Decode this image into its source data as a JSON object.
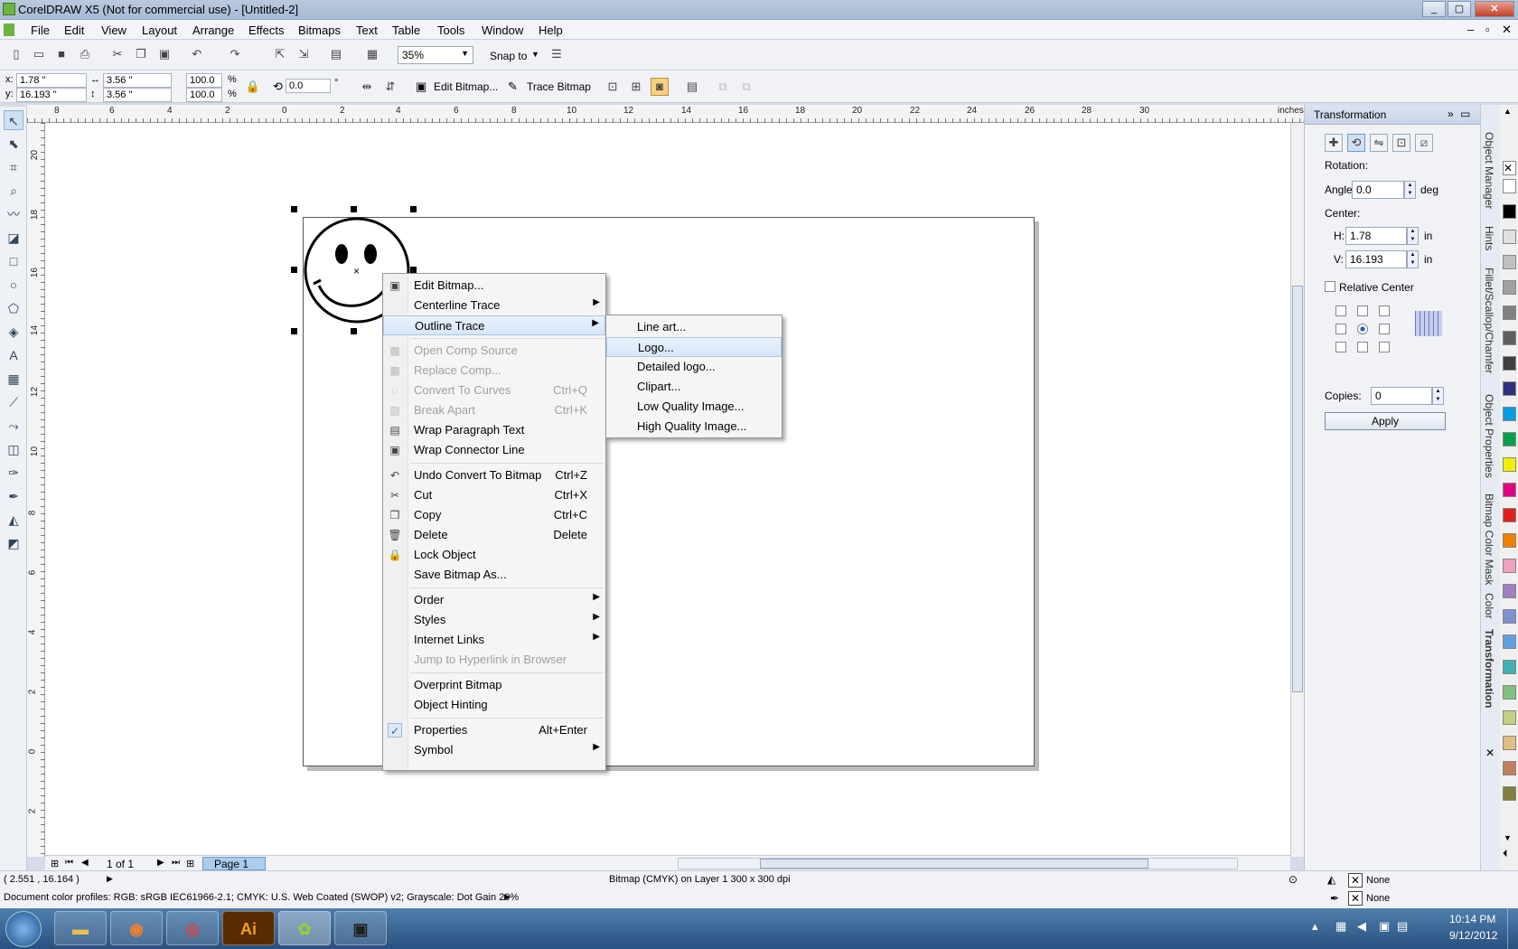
{
  "window": {
    "title": "CorelDRAW X5 (Not for commercial use) - [Untitled-2]"
  },
  "menubar": [
    "File",
    "Edit",
    "View",
    "Layout",
    "Arrange",
    "Effects",
    "Bitmaps",
    "Text",
    "Table",
    "Tools",
    "Window",
    "Help"
  ],
  "std_toolbar": {
    "zoom": "35%",
    "snap": "Snap to"
  },
  "property_bar": {
    "x_label": "x:",
    "x": "1.78 \"",
    "y_label": "y:",
    "y": "16.193 \"",
    "w": "3.56 \"",
    "h": "3.56 \"",
    "scale_x": "100.0",
    "scale_y": "100.0",
    "pct": "%",
    "angle": "0.0",
    "deg_sym": "°",
    "edit_bitmap": "Edit Bitmap...",
    "trace_bitmap": "Trace Bitmap"
  },
  "ruler": {
    "h_ticks": [
      "8",
      "6",
      "4",
      "2",
      "0",
      "2",
      "4",
      "6",
      "8",
      "10",
      "12",
      "14",
      "16",
      "18",
      "20",
      "22",
      "24",
      "26",
      "28",
      "30"
    ],
    "unit": "inches",
    "v_ticks": [
      "20",
      "18",
      "16",
      "14",
      "12",
      "10",
      "8",
      "6",
      "4",
      "2",
      "0",
      "2"
    ]
  },
  "context_menu": {
    "items": [
      {
        "label": "Edit Bitmap...",
        "icon": "edit-bitmap-icon"
      },
      {
        "label": "Centerline Trace",
        "submenu": true
      },
      {
        "label": "Outline Trace",
        "submenu": true,
        "highlighted": true
      },
      {
        "label": "Open Comp Source",
        "disabled": true
      },
      {
        "label": "Replace Comp...",
        "disabled": true
      },
      {
        "label": "Convert To Curves",
        "shortcut": "Ctrl+Q",
        "disabled": true
      },
      {
        "label": "Break Apart",
        "shortcut": "Ctrl+K",
        "disabled": true
      },
      {
        "label": "Wrap Paragraph Text"
      },
      {
        "label": "Wrap Connector Line"
      },
      {
        "label": "Undo Convert To Bitmap",
        "shortcut": "Ctrl+Z"
      },
      {
        "label": "Cut",
        "shortcut": "Ctrl+X"
      },
      {
        "label": "Copy",
        "shortcut": "Ctrl+C"
      },
      {
        "label": "Delete",
        "shortcut": "Delete"
      },
      {
        "label": "Lock Object"
      },
      {
        "label": "Save Bitmap As..."
      },
      {
        "label": "Order",
        "submenu": true
      },
      {
        "label": "Styles",
        "submenu": true
      },
      {
        "label": "Internet Links",
        "submenu": true
      },
      {
        "label": "Jump to Hyperlink in Browser",
        "disabled": true
      },
      {
        "label": "Overprint Bitmap"
      },
      {
        "label": "Object Hinting"
      },
      {
        "label": "Properties",
        "shortcut": "Alt+Enter",
        "checked": true
      },
      {
        "label": "Symbol",
        "submenu": true
      }
    ]
  },
  "submenu": {
    "items": [
      "Line art...",
      "Logo...",
      "Detailed logo...",
      "Clipart...",
      "Low Quality Image...",
      "High Quality Image..."
    ],
    "highlighted": "Logo..."
  },
  "docker": {
    "title": "Transformation",
    "rotation_label": "Rotation:",
    "angle_label": "Angle:",
    "angle": "0.0",
    "deg": "deg",
    "center_label": "Center:",
    "h_label": "H:",
    "h": "1.78",
    "v_label": "V:",
    "v": "16.193",
    "unit": "in",
    "relative_center": "Relative Center",
    "copies_label": "Copies:",
    "copies": "0",
    "apply": "Apply"
  },
  "docker_tabs": [
    "Object Manager",
    "Hints",
    "Fillet/Scallop/Chamfer",
    "Object Properties",
    "Bitmap Color Mask",
    "Color",
    "Transformation"
  ],
  "palette_colors": [
    "#ffffff",
    "#000000",
    "#e0e0e0",
    "#c0c0c0",
    "#a0a0a0",
    "#808080",
    "#606060",
    "#404040",
    "#303080",
    "#00a0e0",
    "#00a050",
    "#f0f000",
    "#e00080",
    "#e02020",
    "#f08000",
    "#f0a0c0",
    "#a080c0",
    "#8090d0",
    "#60a0e0",
    "#40b0b0",
    "#80c080",
    "#c0d080",
    "#e0c080",
    "#c08060",
    "#808040"
  ],
  "page_nav": {
    "count": "1 of 1",
    "page_tab": "Page 1"
  },
  "status": {
    "coords": "( 2.551 , 16.164 )",
    "info": "Bitmap (CMYK) on Layer 1 300 x 300 dpi",
    "profiles": "Document color profiles: RGB: sRGB IEC61966-2.1; CMYK: U.S. Web Coated (SWOP) v2; Grayscale: Dot Gain 20%",
    "fill": "None",
    "outline": "None"
  },
  "taskbar": {
    "time": "10:14 PM",
    "date": "9/12/2012"
  }
}
